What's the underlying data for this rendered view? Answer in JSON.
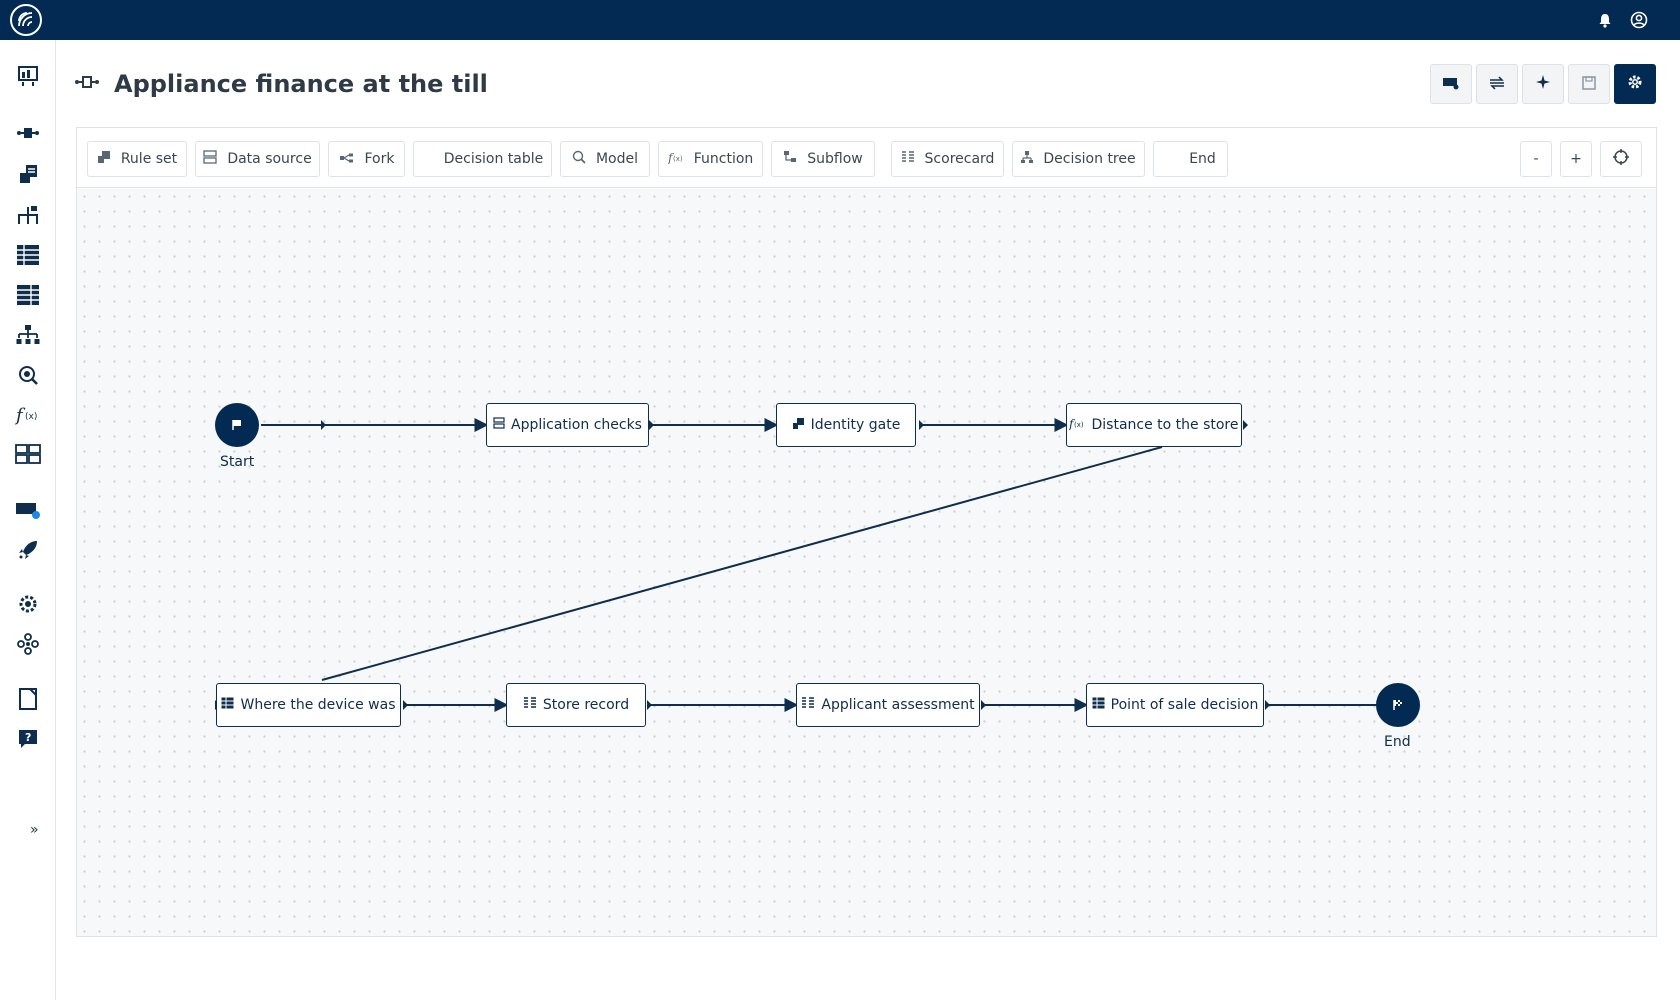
{
  "header": {
    "title": "Appliance finance at the till"
  },
  "palette": {
    "labels": [
      "Rule set",
      "Data source",
      "Fork",
      "Decision table",
      "Model",
      "Function",
      "Subflow",
      "Scorecard",
      "Decision tree",
      "End"
    ],
    "zoom_out": "-",
    "zoom_in": "+"
  },
  "flow": {
    "start_label": "Start",
    "end_label": "End",
    "nodes": [
      "Application checks",
      "Identity gate",
      "Distance to the store",
      "Where the device was",
      "Store record",
      "Applicant assessment",
      "Point of sale decision"
    ]
  },
  "sidebar": {
    "expand": "»"
  },
  "colors": {
    "navy": "#022a52",
    "node_border": "#0f2d4c"
  },
  "icons": [
    "bell-icon",
    "user-circle-icon",
    "dashboard-icon",
    "flow-icon",
    "ruleset-icon",
    "data-source-icon",
    "decision-table-icon",
    "tree-icon",
    "model-icon",
    "function-icon",
    "scorecard-icon",
    "help-icon"
  ]
}
